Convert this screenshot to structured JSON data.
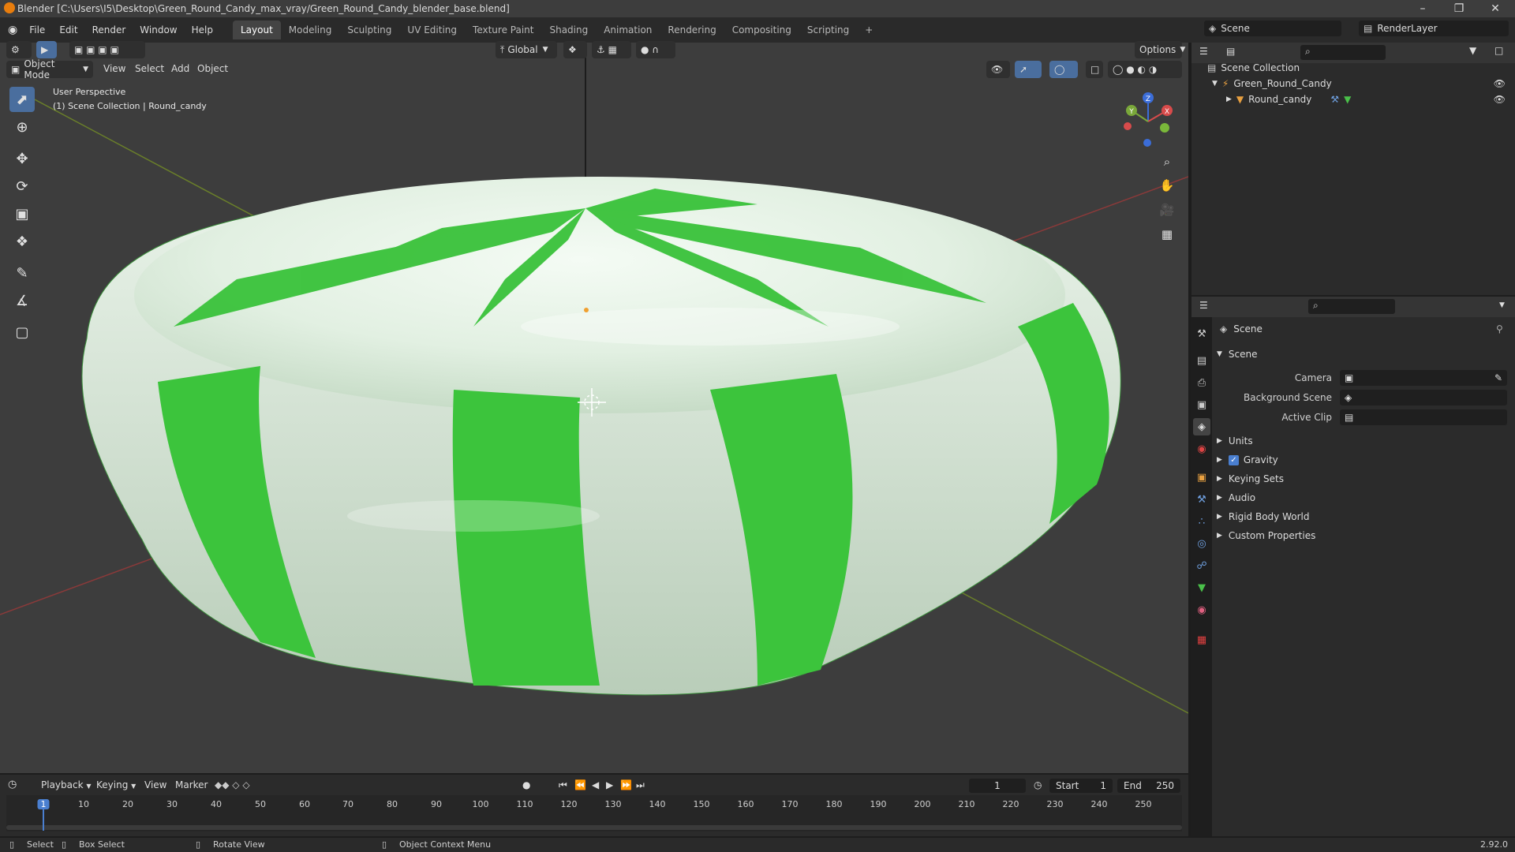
{
  "window": {
    "title": "Blender [C:\\Users\\I5\\Desktop\\Green_Round_Candy_max_vray/Green_Round_Candy_blender_base.blend]"
  },
  "menubar": {
    "items": [
      "File",
      "Edit",
      "Render",
      "Window",
      "Help"
    ],
    "workspaces": [
      "Layout",
      "Modeling",
      "Sculpting",
      "UV Editing",
      "Texture Paint",
      "Shading",
      "Animation",
      "Rendering",
      "Compositing",
      "Scripting"
    ],
    "active_workspace": "Layout",
    "add_tab": "+",
    "scene_name": "Scene",
    "render_layer": "RenderLayer"
  },
  "viewport": {
    "mode": "Object Mode",
    "menus": [
      "View",
      "Select",
      "Add",
      "Object"
    ],
    "transform_orientation": "Global",
    "options_label": "Options",
    "overlay_title": "User Perspective",
    "overlay_subtitle": "(1) Scene Collection | Round_candy",
    "gizmo_axes": [
      "X",
      "Y",
      "Z"
    ]
  },
  "outliner": {
    "root": "Scene Collection",
    "items": [
      {
        "name": "Green_Round_Candy",
        "level": 1
      },
      {
        "name": "Round_candy",
        "level": 2
      }
    ]
  },
  "properties": {
    "context_title": "Scene",
    "panel_title": "Scene",
    "fields": [
      {
        "label": "Camera",
        "value": ""
      },
      {
        "label": "Background Scene",
        "value": ""
      },
      {
        "label": "Active Clip",
        "value": ""
      }
    ],
    "subpanels": [
      "Units",
      "Gravity",
      "Keying Sets",
      "Audio",
      "Rigid Body World",
      "Custom Properties"
    ],
    "gravity_checked": true
  },
  "timeline": {
    "menus": [
      "Playback",
      "Keying",
      "View",
      "Marker"
    ],
    "current_frame": "1",
    "start_label": "Start",
    "start_value": "1",
    "end_label": "End",
    "end_value": "250",
    "ruler": [
      "1",
      "10",
      "20",
      "30",
      "40",
      "50",
      "60",
      "70",
      "80",
      "90",
      "100",
      "110",
      "120",
      "130",
      "140",
      "150",
      "160",
      "170",
      "180",
      "190",
      "200",
      "210",
      "220",
      "230",
      "240",
      "250"
    ]
  },
  "statusbar": {
    "select": "Select",
    "box_select": "Box Select",
    "rotate_view": "Rotate View",
    "context_menu": "Object Context Menu",
    "version": "2.92.0"
  }
}
